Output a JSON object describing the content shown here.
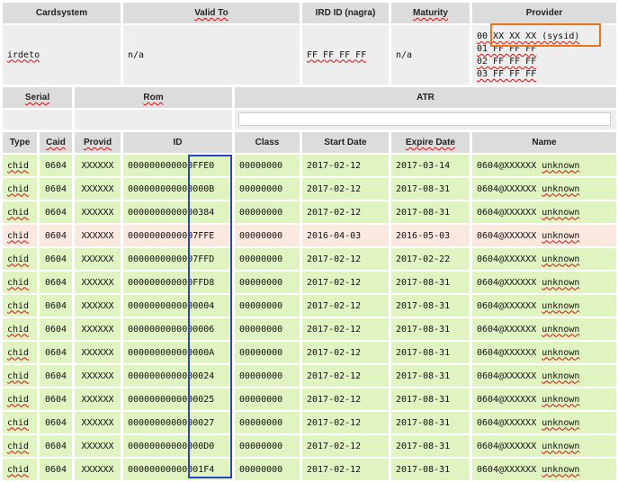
{
  "card_header": {
    "cardsystem": "Cardsystem",
    "valid_to": "Valid To",
    "ird_id": "IRD ID (nagra)",
    "maturity": "Maturity",
    "provider": "Provider"
  },
  "card_info": {
    "cardsystem": "irdeto",
    "valid_to": "n/a",
    "ird_id": "FF FF FF FF",
    "maturity": "n/a",
    "providers": [
      "00 XX XX XX (sysid)",
      "01 FF FF FF",
      "02 FF FF FF",
      "03 FF FF FF"
    ]
  },
  "card_header2": {
    "serial": "Serial",
    "rom": "Rom",
    "atr": "ATR"
  },
  "entitlements": {
    "columns": {
      "type": "Type",
      "caid": "Caid",
      "provid": "Provid",
      "id": "ID",
      "class": "Class",
      "start": "Start Date",
      "expire": "Expire Date",
      "name": "Name"
    },
    "rows": [
      {
        "type": "chid",
        "caid": "0604",
        "provid": "XXXXXX",
        "id": "000000000000FFE0",
        "class": "00000000",
        "start": "2017-02-12",
        "expire": "2017-03-14",
        "name": "0604@XXXXXX unknown",
        "status": "active"
      },
      {
        "type": "chid",
        "caid": "0604",
        "provid": "XXXXXX",
        "id": "000000000000000B",
        "class": "00000000",
        "start": "2017-02-12",
        "expire": "2017-08-31",
        "name": "0604@XXXXXX unknown",
        "status": "active"
      },
      {
        "type": "chid",
        "caid": "0604",
        "provid": "XXXXXX",
        "id": "0000000000000384",
        "class": "00000000",
        "start": "2017-02-12",
        "expire": "2017-08-31",
        "name": "0604@XXXXXX unknown",
        "status": "active"
      },
      {
        "type": "chid",
        "caid": "0604",
        "provid": "XXXXXX",
        "id": "0000000000007FFE",
        "class": "00000000",
        "start": "2016-04-03",
        "expire": "2016-05-03",
        "name": "0604@XXXXXX unknown",
        "status": "expired"
      },
      {
        "type": "chid",
        "caid": "0604",
        "provid": "XXXXXX",
        "id": "0000000000007FFD",
        "class": "00000000",
        "start": "2017-02-12",
        "expire": "2017-02-22",
        "name": "0604@XXXXXX unknown",
        "status": "active"
      },
      {
        "type": "chid",
        "caid": "0604",
        "provid": "XXXXXX",
        "id": "000000000000FFD8",
        "class": "00000000",
        "start": "2017-02-12",
        "expire": "2017-08-31",
        "name": "0604@XXXXXX unknown",
        "status": "active"
      },
      {
        "type": "chid",
        "caid": "0604",
        "provid": "XXXXXX",
        "id": "0000000000000004",
        "class": "00000000",
        "start": "2017-02-12",
        "expire": "2017-08-31",
        "name": "0604@XXXXXX unknown",
        "status": "active"
      },
      {
        "type": "chid",
        "caid": "0604",
        "provid": "XXXXXX",
        "id": "0000000000000006",
        "class": "00000000",
        "start": "2017-02-12",
        "expire": "2017-08-31",
        "name": "0604@XXXXXX unknown",
        "status": "active"
      },
      {
        "type": "chid",
        "caid": "0604",
        "provid": "XXXXXX",
        "id": "000000000000000A",
        "class": "00000000",
        "start": "2017-02-12",
        "expire": "2017-08-31",
        "name": "0604@XXXXXX unknown",
        "status": "active"
      },
      {
        "type": "chid",
        "caid": "0604",
        "provid": "XXXXXX",
        "id": "0000000000000024",
        "class": "00000000",
        "start": "2017-02-12",
        "expire": "2017-08-31",
        "name": "0604@XXXXXX unknown",
        "status": "active"
      },
      {
        "type": "chid",
        "caid": "0604",
        "provid": "XXXXXX",
        "id": "0000000000000025",
        "class": "00000000",
        "start": "2017-02-12",
        "expire": "2017-08-31",
        "name": "0604@XXXXXX unknown",
        "status": "active"
      },
      {
        "type": "chid",
        "caid": "0604",
        "provid": "XXXXXX",
        "id": "0000000000000027",
        "class": "00000000",
        "start": "2017-02-12",
        "expire": "2017-08-31",
        "name": "0604@XXXXXX unknown",
        "status": "active"
      },
      {
        "type": "chid",
        "caid": "0604",
        "provid": "XXXXXX",
        "id": "00000000000000D0",
        "class": "00000000",
        "start": "2017-02-12",
        "expire": "2017-08-31",
        "name": "0604@XXXXXX unknown",
        "status": "active"
      },
      {
        "type": "chid",
        "caid": "0604",
        "provid": "XXXXXX",
        "id": "00000000000001F4",
        "class": "00000000",
        "start": "2017-02-12",
        "expire": "2017-08-31",
        "name": "0604@XXXXXX unknown",
        "status": "active"
      }
    ]
  },
  "colors": {
    "header_bg": "#dcdcdc",
    "info_bg": "#eeeeee",
    "active_row_bg": "#e0f4c2",
    "expired_row_bg": "#fbe9e0",
    "highlight_orange": "#e8761a",
    "highlight_blue": "#2a45c8"
  }
}
